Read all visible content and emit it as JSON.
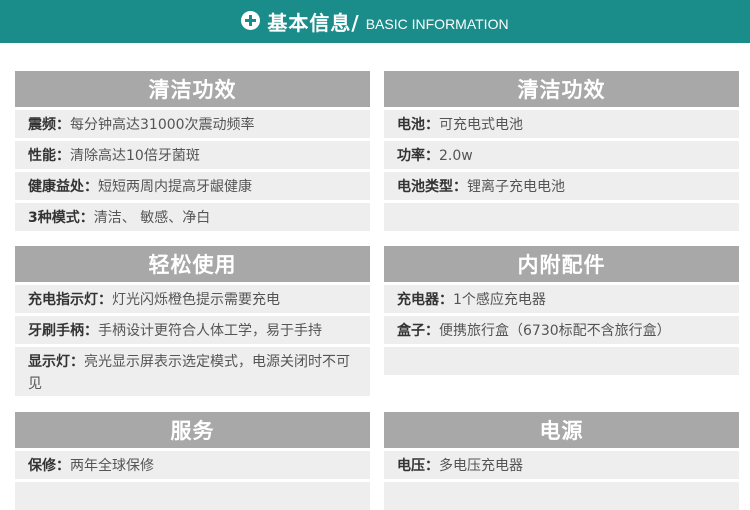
{
  "banner": {
    "title_cn": "基本信息/",
    "title_en": "BASIC INFORMATION"
  },
  "cards": {
    "clean_effect": {
      "title": "清洁功效",
      "rows": [
        {
          "key": "震频：",
          "value": "每分钟高达31000次震动频率"
        },
        {
          "key": "性能：",
          "value": "清除高达10倍牙菌斑"
        },
        {
          "key": "健康益处：",
          "value": "短短两周内提高牙龈健康"
        },
        {
          "key": "3种模式：",
          "value": "清洁、 敏感、净白"
        }
      ]
    },
    "clean_effect_2": {
      "title": "清洁功效",
      "rows": [
        {
          "key": "电池：",
          "value": "可充电式电池"
        },
        {
          "key": "功率：",
          "value": "2.0w"
        },
        {
          "key": "电池类型：",
          "value": "锂离子充电电池"
        },
        {
          "key": "",
          "value": ""
        }
      ]
    },
    "easy_use": {
      "title": "轻松使用",
      "rows": [
        {
          "key": "充电指示灯：",
          "value": "灯光闪烁橙色提示需要充电"
        },
        {
          "key": "牙刷手柄：",
          "value": "手柄设计更符合人体工学，易于手持"
        },
        {
          "key": "显示灯：",
          "value": "亮光显示屏表示选定模式，电源关闭时不可见"
        }
      ]
    },
    "accessories": {
      "title": "内附配件",
      "rows": [
        {
          "key": "充电器：",
          "value": "1个感应充电器"
        },
        {
          "key": "盒子：",
          "value": "便携旅行盒（6730标配不含旅行盒）"
        },
        {
          "key": "",
          "value": ""
        }
      ]
    },
    "service": {
      "title": "服务",
      "rows": [
        {
          "key": "保修：",
          "value": "两年全球保修"
        },
        {
          "key": "",
          "value": ""
        }
      ]
    },
    "power": {
      "title": "电源",
      "rows": [
        {
          "key": "电压：",
          "value": "多电压充电器"
        },
        {
          "key": "",
          "value": ""
        }
      ]
    }
  }
}
